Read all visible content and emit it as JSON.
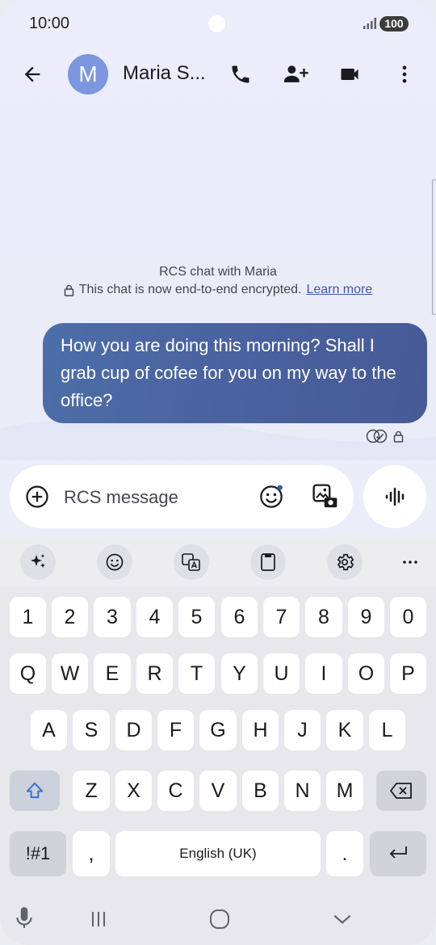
{
  "status_bar": {
    "time": "10:00",
    "battery": "100"
  },
  "app_bar": {
    "contact_initial": "M",
    "contact_name": "Maria S..."
  },
  "chat": {
    "info_title": "RCS chat with Maria",
    "encryption_text": "This chat is now end-to-end encrypted.",
    "learn_more": "Learn more",
    "messages": [
      {
        "text": "How you are doing this morning? Shall I grab cup of cofee for you on my way to the office?"
      }
    ]
  },
  "composer": {
    "placeholder": "RCS message"
  },
  "keyboard": {
    "row_numbers": [
      "1",
      "2",
      "3",
      "4",
      "5",
      "6",
      "7",
      "8",
      "9",
      "0"
    ],
    "row_1": [
      "Q",
      "W",
      "E",
      "R",
      "T",
      "Y",
      "U",
      "I",
      "O",
      "P"
    ],
    "row_2": [
      "A",
      "S",
      "D",
      "F",
      "G",
      "H",
      "J",
      "K",
      "L"
    ],
    "row_3": [
      "Z",
      "X",
      "C",
      "V",
      "B",
      "N",
      "M"
    ],
    "symbols_key": "!#1",
    "comma_key": ",",
    "space_label": "English (UK)",
    "period_key": "."
  },
  "colors": {
    "accent": "#4A62A0",
    "avatar": "#7C96E0"
  }
}
